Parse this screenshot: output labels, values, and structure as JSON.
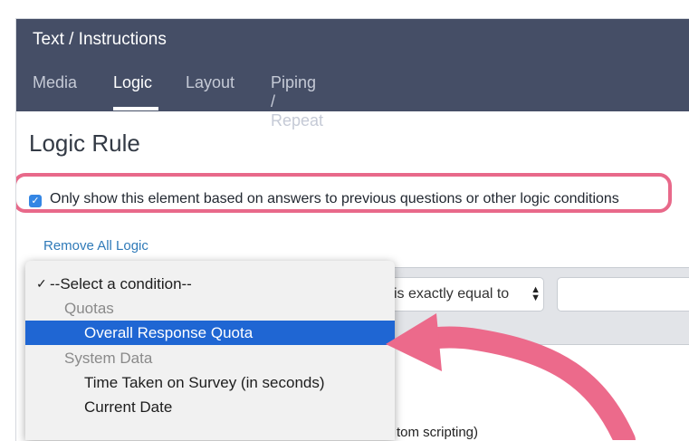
{
  "header": {
    "title": "Text / Instructions",
    "tabs": [
      "Media",
      "Logic",
      "Layout",
      "Piping / Repeat"
    ],
    "active_tab": "Logic"
  },
  "main": {
    "title": "Logic Rule",
    "checkbox_label": "Only show this element based on answers to previous questions or other logic conditions",
    "checkbox_checked": true,
    "remove_link": "Remove All Logic",
    "operator_value": "is exactly equal to",
    "value_input": ""
  },
  "dropdown": {
    "checkmark": "✓",
    "items": [
      {
        "label": "--Select a condition--",
        "kind": "option",
        "checked": true
      },
      {
        "label": "Quotas",
        "kind": "group"
      },
      {
        "label": "Overall Response Quota",
        "kind": "option",
        "selected": true
      },
      {
        "label": "System Data",
        "kind": "group"
      },
      {
        "label": "Time Taken on Survey (in seconds)",
        "kind": "option"
      },
      {
        "label": "Current Date",
        "kind": "option"
      }
    ]
  },
  "background": {
    "partial_text": "tom scripting)"
  },
  "colors": {
    "header_bg": "#454e66",
    "highlight": "#e8698a",
    "selected": "#1f66d3",
    "arrow": "#ec6a8b"
  }
}
